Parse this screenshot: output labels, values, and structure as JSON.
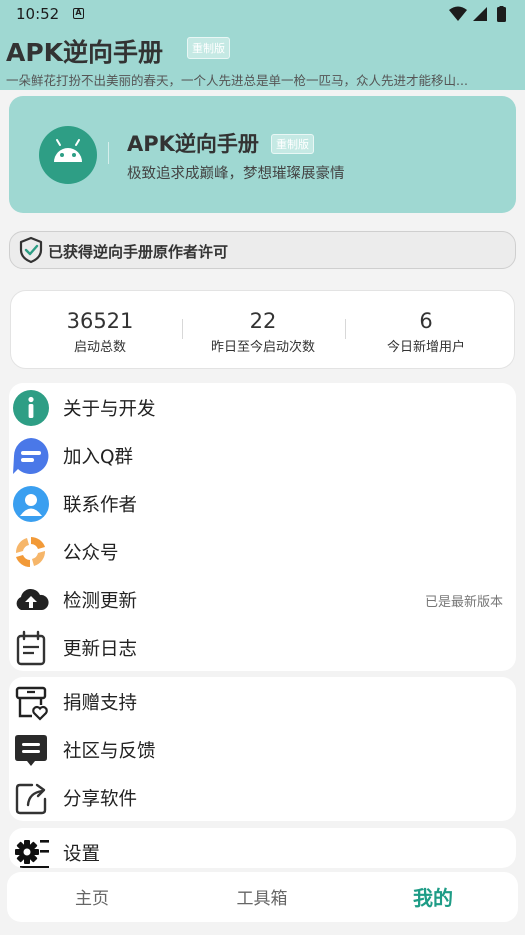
{
  "status_bar": {
    "time": "10:52",
    "notification_icon": "A"
  },
  "app_bar": {
    "title": "APK逆向手册",
    "badge": "重制版",
    "marquee": "一朵鲜花打扮不出美丽的春天，一个人先进总是单一枪一匹马，众人先进才能移山..."
  },
  "hero": {
    "icon": "android-icon",
    "name": "APK逆向手册",
    "badge": "重制版",
    "slogan": "极致追求成巅峰，梦想璀璨展豪情"
  },
  "notice": {
    "icon": "shield-check-icon",
    "text": "已获得逆向手册原作者许可"
  },
  "stats": [
    {
      "value": "36521",
      "label": "启动总数"
    },
    {
      "value": "22",
      "label": "昨日至今启动次数"
    },
    {
      "value": "6",
      "label": "今日新增用户"
    }
  ],
  "menu_group_1": [
    {
      "icon": "info-icon",
      "label": "关于与开发"
    },
    {
      "icon": "chat-group-icon",
      "label": "加入Q群"
    },
    {
      "icon": "user-icon",
      "label": "联系作者"
    },
    {
      "icon": "public-account-icon",
      "label": "公众号"
    },
    {
      "icon": "cloud-upload-icon",
      "label": "检测更新",
      "value": "已是最新版本"
    },
    {
      "icon": "calendar-log-icon",
      "label": "更新日志"
    }
  ],
  "menu_group_2": [
    {
      "icon": "donate-icon",
      "label": "捐赠支持"
    },
    {
      "icon": "message-icon",
      "label": "社区与反馈"
    },
    {
      "icon": "share-icon",
      "label": "分享软件"
    }
  ],
  "menu_group_3": [
    {
      "icon": "settings-icon",
      "label": "设置"
    }
  ],
  "bottom_nav": {
    "tabs": [
      {
        "label": "主页",
        "active": false
      },
      {
        "label": "工具箱",
        "active": false
      },
      {
        "label": "我的",
        "active": true
      }
    ]
  },
  "colors": {
    "accent": "#9fd8d2",
    "primary": "#1e9c86",
    "background": "#f3f3f3"
  }
}
